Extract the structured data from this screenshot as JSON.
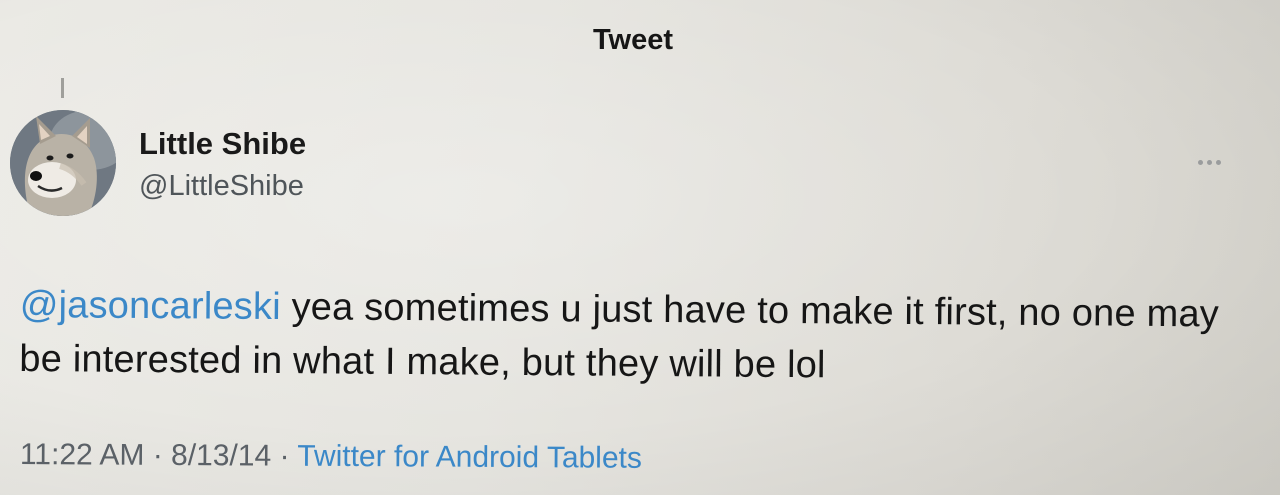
{
  "header": {
    "title": "Tweet"
  },
  "tweet": {
    "author": {
      "display_name": "Little Shibe",
      "handle": "@LittleShibe",
      "avatar_icon": "shiba-dog-avatar"
    },
    "more_icon": "more-horizontal-icon",
    "mention": "@jasoncarleski",
    "body_text": " yea sometimes u just have to make it first, no one may be interested in what I make, but they will be lol",
    "time": "11:22 AM",
    "separator": " · ",
    "date": "8/13/14",
    "source": "Twitter for Android Tablets"
  },
  "colors": {
    "link": "#3b88c8",
    "text": "#161616",
    "secondary_text": "#5b6167",
    "background": "#e6e5e0"
  }
}
